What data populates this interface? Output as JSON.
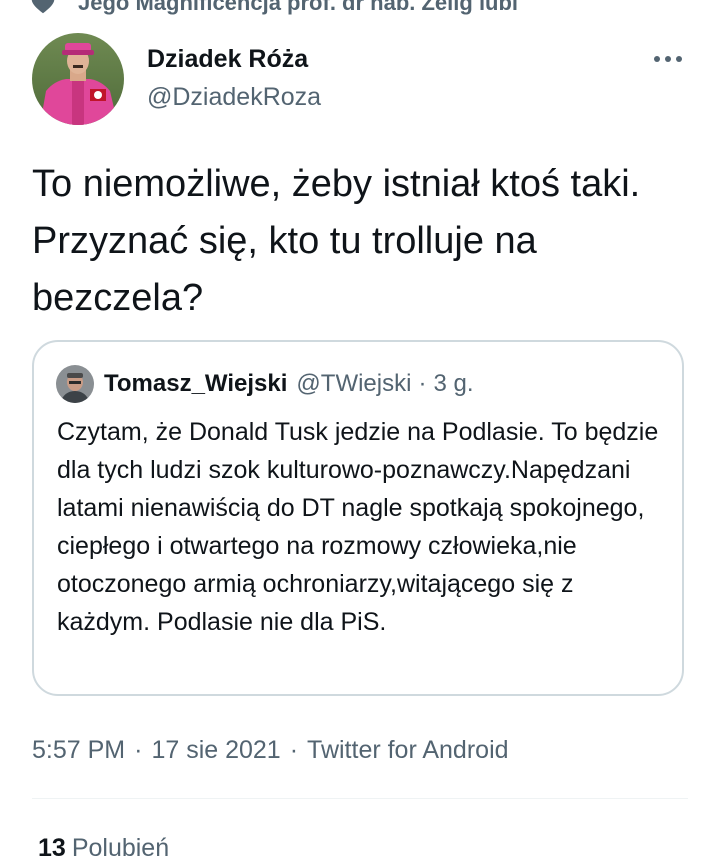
{
  "social_context": {
    "text": "Jego Magnificencja prof. dr hab. Zelig lubi",
    "icon": "heart-icon"
  },
  "author": {
    "display_name": "Dziadek Róża",
    "handle": "@DziadekRoza",
    "avatar_icon": "profile-photo"
  },
  "more_icon": "more-dots-icon",
  "tweet": {
    "text": "To niemożliwe, żeby istniał ktoś taki. Przyznać się, kto tu trolluje na bezczela?"
  },
  "quote": {
    "display_name": "Tomasz_Wiejski",
    "handle": "@TWiejski",
    "separator": "·",
    "time": "3 g.",
    "text": "Czytam, że Donald Tusk jedzie na Podlasie. To będzie dla tych ludzi szok kulturowo-poznawczy.Napędzani latami nienawiścią do DT nagle spotkają spokojnego, ciepłego i otwartego na rozmowy człowieka,nie otoczonego armią ochroniarzy,witającego się z każdym. Podlasie nie dla PiS."
  },
  "meta": {
    "time": "5:57 PM",
    "separator": "·",
    "date": "17 sie 2021",
    "source": "Twitter for Android"
  },
  "stats": {
    "likes_count": "13",
    "likes_label": "Polubień"
  },
  "colors": {
    "text_primary": "#0f1419",
    "text_secondary": "#536471",
    "border": "#cfd9de",
    "divider": "#eff3f4"
  }
}
